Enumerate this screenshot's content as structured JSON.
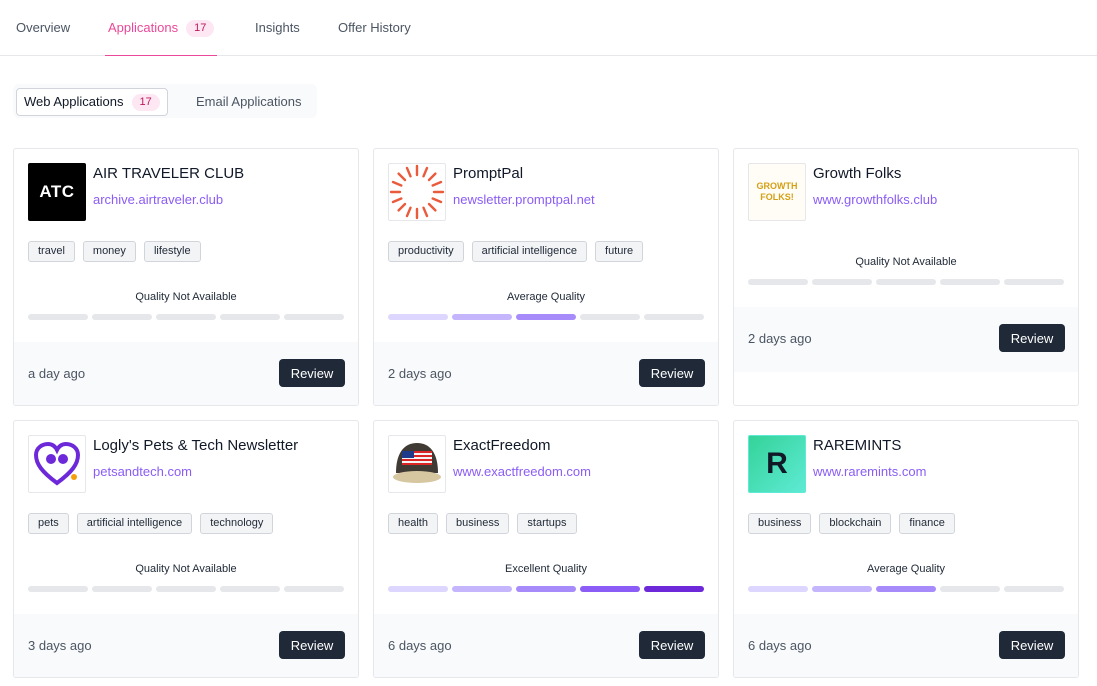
{
  "tabs": [
    {
      "label": "Overview"
    },
    {
      "label": "Applications",
      "count": "17"
    },
    {
      "label": "Insights"
    },
    {
      "label": "Offer History"
    }
  ],
  "subtabs": [
    {
      "label": "Web Applications",
      "count": "17"
    },
    {
      "label": "Email Applications"
    }
  ],
  "button_label": "Review",
  "quality_colors": [
    "#ddd6fe",
    "#c4b5fd",
    "#a78bfa",
    "#8b5cf6",
    "#6d28d9"
  ],
  "cards": [
    {
      "title": "AIR TRAVELER CLUB",
      "url": "archive.airtraveler.club",
      "logo_icon": "atc-logo",
      "logo_text": "ATC",
      "tags": [
        "travel",
        "money",
        "lifestyle"
      ],
      "quality": "Quality Not Available",
      "quality_level": 0,
      "time": "a day ago"
    },
    {
      "title": "PromptPal",
      "url": "newsletter.promptpal.net",
      "logo_icon": "promptpal-sunburst-logo",
      "tags": [
        "productivity",
        "artificial intelligence",
        "future"
      ],
      "quality": "Average Quality",
      "quality_level": 3,
      "time": "2 days ago"
    },
    {
      "title": "Growth Folks",
      "url": "www.growthfolks.club",
      "logo_icon": "growth-folks-logo",
      "logo_text": "GROWTH FOLKS!",
      "tags": [],
      "quality": "Quality Not Available",
      "quality_level": 0,
      "time": "2 days ago"
    },
    {
      "title": "Logly's Pets & Tech Newsletter",
      "url": "petsandtech.com",
      "logo_icon": "pets-heart-logo",
      "tags": [
        "pets",
        "artificial intelligence",
        "technology"
      ],
      "quality": "Quality Not Available",
      "quality_level": 0,
      "time": "3 days ago"
    },
    {
      "title": "ExactFreedom",
      "url": "www.exactfreedom.com",
      "logo_icon": "flag-cap-logo",
      "tags": [
        "health",
        "business",
        "startups"
      ],
      "quality": "Excellent Quality",
      "quality_level": 5,
      "time": "6 days ago"
    },
    {
      "title": "RAREMINTS",
      "url": "www.raremints.com",
      "logo_icon": "raremints-logo",
      "logo_text": "R",
      "tags": [
        "business",
        "blockchain",
        "finance"
      ],
      "quality": "Average Quality",
      "quality_level": 3,
      "time": "6 days ago"
    }
  ]
}
